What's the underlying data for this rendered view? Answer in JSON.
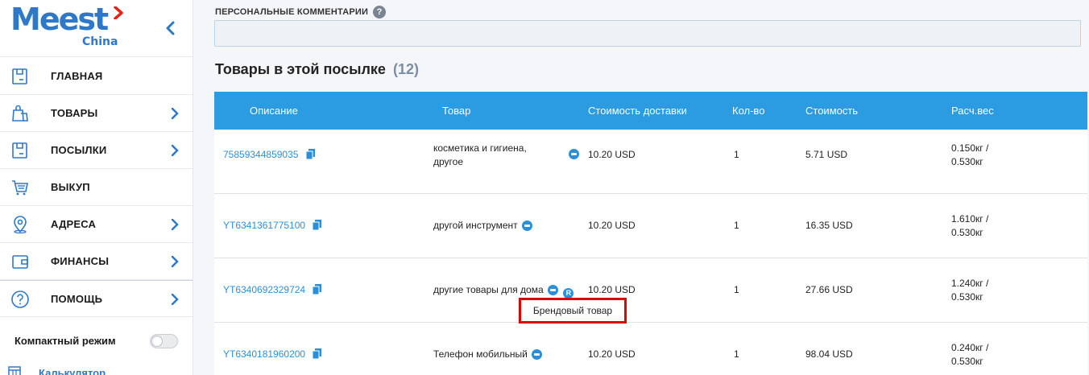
{
  "logo": {
    "main": "Meest",
    "sub": "China"
  },
  "nav": [
    {
      "label": "ГЛАВНАЯ",
      "icon": "box-icon",
      "arrow": false
    },
    {
      "label": "ТОВАРЫ",
      "icon": "shopping-bag-icon",
      "arrow": true
    },
    {
      "label": "ПОСЫЛКИ",
      "icon": "box-icon",
      "arrow": true
    },
    {
      "label": "ВЫКУП",
      "icon": "cart-icon",
      "arrow": false
    },
    {
      "label": "АДРЕСА",
      "icon": "location-pin-icon",
      "arrow": true
    },
    {
      "label": "ФИНАНСЫ",
      "icon": "wallet-icon",
      "arrow": true
    },
    {
      "label": "ПОМОЩЬ",
      "icon": "question-circle-icon",
      "arrow": true
    }
  ],
  "compact": {
    "label": "Компактный режим"
  },
  "calculator": {
    "label": "Калькулятор"
  },
  "comments": {
    "label": "ПЕРСОНАЛЬНЫЕ КОММЕНТАРИИ",
    "help": "?",
    "value": ""
  },
  "section": {
    "title": "Товары в этой посылке",
    "count": "(12)"
  },
  "table": {
    "headers": [
      "Описание",
      "Товар",
      "Стоимость доставки",
      "Кол-во",
      "Стоимость",
      "Расч.вес"
    ],
    "rows": [
      {
        "track": "75859344859035",
        "item_line1": "косметика и гигиена,",
        "item_line2": "другое",
        "delivery": "10.20 USD",
        "qty": "1",
        "cost": "5.71 USD",
        "weight1": "0.150кг /",
        "weight2": "0.530кг"
      },
      {
        "track": "YT6341361775100",
        "item_line1": "другой инструмент",
        "item_line2": "",
        "delivery": "10.20 USD",
        "qty": "1",
        "cost": "16.35 USD",
        "weight1": "1.610кг /",
        "weight2": "0.530кг"
      },
      {
        "track": "YT6340692329724",
        "item_line1": "другие товары для дома",
        "item_line2": "",
        "delivery": "10.20 USD",
        "qty": "1",
        "cost": "27.66 USD",
        "weight1": "1.240кг /",
        "weight2": "0.530кг"
      },
      {
        "track": "YT6340181960200",
        "item_line1": "Телефон мобильный",
        "item_line2": "",
        "delivery": "10.20 USD",
        "qty": "1",
        "cost": "98.04 USD",
        "weight1": "0.240кг /",
        "weight2": "0.530кг"
      }
    ]
  },
  "tooltip": {
    "text": "Брендовый товар"
  },
  "colors": {
    "brand": "#2d78c9",
    "header": "#2b9be2",
    "link": "#2d8fd6",
    "highlight": "#e00000"
  }
}
